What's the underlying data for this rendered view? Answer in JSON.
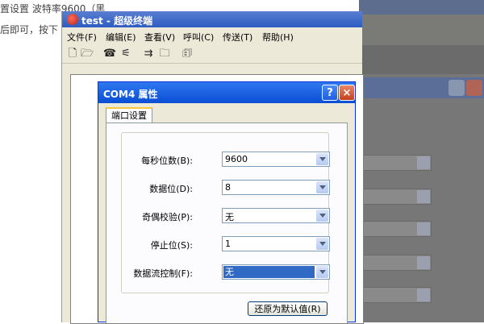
{
  "background": {
    "line1": "置设置 波特率9600（黑",
    "line2": "后即可，按下"
  },
  "app": {
    "title": "test - 超级终端",
    "menu": [
      {
        "label": "文件(F)"
      },
      {
        "label": "编辑(E)"
      },
      {
        "label": "查看(V)"
      },
      {
        "label": "呼叫(C)"
      },
      {
        "label": "传送(T)"
      },
      {
        "label": "帮助(H)"
      }
    ],
    "toolbar": [
      "new-icon",
      "open-icon",
      "phone-icon",
      "disconnect-icon",
      "send-icon",
      "receive-icon",
      "properties-icon"
    ]
  },
  "dialog": {
    "title": "COM4 属性",
    "help_label": "?",
    "close_label": "×",
    "tab_label": "端口设置",
    "fields": [
      {
        "label": "每秒位数(B):",
        "value": "9600"
      },
      {
        "label": "数据位(D):",
        "value": "8"
      },
      {
        "label": "奇偶校验(P):",
        "value": "无"
      },
      {
        "label": "停止位(S):",
        "value": "1"
      },
      {
        "label": "数据流控制(F):",
        "value": "无"
      }
    ],
    "restore_label": "还原为默认值(R)"
  },
  "colors": {
    "title_bar": "#0a4ed4",
    "selection": "#316ac5"
  }
}
